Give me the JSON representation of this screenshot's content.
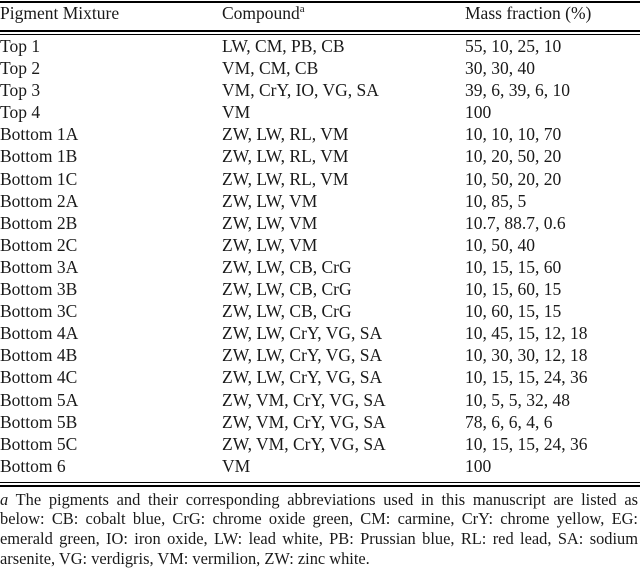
{
  "table": {
    "footnote_marker": "a",
    "columns": [
      {
        "key": "mixture",
        "label": "Pigment Mixture"
      },
      {
        "key": "compound",
        "label": "Compound"
      },
      {
        "key": "mass",
        "label": "Mass fraction (%)"
      }
    ],
    "rows": [
      {
        "mixture": "Top 1",
        "compound": "LW, CM, PB, CB",
        "mass": "55, 10, 25, 10"
      },
      {
        "mixture": "Top 2",
        "compound": "VM, CM, CB",
        "mass": "30, 30, 40"
      },
      {
        "mixture": "Top 3",
        "compound": "VM, CrY, IO, VG, SA",
        "mass": "39, 6, 39, 6, 10"
      },
      {
        "mixture": "Top 4",
        "compound": "VM",
        "mass": "100"
      },
      {
        "mixture": "Bottom 1A",
        "compound": "ZW, LW, RL, VM",
        "mass": "10, 10, 10, 70"
      },
      {
        "mixture": "Bottom 1B",
        "compound": "ZW, LW, RL, VM",
        "mass": "10, 20, 50, 20"
      },
      {
        "mixture": "Bottom 1C",
        "compound": "ZW, LW, RL, VM",
        "mass": "10, 50, 20, 20"
      },
      {
        "mixture": "Bottom 2A",
        "compound": "ZW, LW, VM",
        "mass": "10, 85, 5"
      },
      {
        "mixture": "Bottom 2B",
        "compound": "ZW, LW, VM",
        "mass": "10.7, 88.7, 0.6"
      },
      {
        "mixture": "Bottom 2C",
        "compound": "ZW, LW, VM",
        "mass": "10, 50, 40"
      },
      {
        "mixture": "Bottom 3A",
        "compound": "ZW, LW, CB, CrG",
        "mass": "10, 15, 15, 60"
      },
      {
        "mixture": "Bottom 3B",
        "compound": "ZW, LW, CB, CrG",
        "mass": "10, 15, 60, 15"
      },
      {
        "mixture": "Bottom 3C",
        "compound": "ZW, LW, CB, CrG",
        "mass": "10, 60, 15, 15"
      },
      {
        "mixture": "Bottom 4A",
        "compound": "ZW, LW, CrY, VG, SA",
        "mass": "10, 45, 15, 12, 18"
      },
      {
        "mixture": "Bottom 4B",
        "compound": "ZW, LW, CrY, VG, SA",
        "mass": "10, 30, 30, 12, 18"
      },
      {
        "mixture": "Bottom 4C",
        "compound": "ZW, LW, CrY, VG, SA",
        "mass": "10, 15, 15, 24, 36"
      },
      {
        "mixture": "Bottom 5A",
        "compound": "ZW, VM, CrY, VG, SA",
        "mass": "10, 5, 5, 32, 48"
      },
      {
        "mixture": "Bottom 5B",
        "compound": "ZW, VM, CrY, VG, SA",
        "mass": "78, 6, 6, 4, 6"
      },
      {
        "mixture": "Bottom 5C",
        "compound": "ZW, VM, CrY, VG, SA",
        "mass": "10, 15, 15, 24, 36"
      },
      {
        "mixture": "Bottom 6",
        "compound": "VM",
        "mass": "100"
      }
    ]
  },
  "footnote": {
    "letter": "a",
    "text": "The pigments and their corresponding abbreviations used in this manuscript are listed as below: CB: cobalt blue, CrG: chrome oxide green, CM: carmine, CrY: chrome yellow, EG: emerald green, IO: iron oxide, LW: lead white, PB: Prussian blue, RL: red lead, SA: sodium arsenite, VG: verdigris, VM: vermilion, ZW: zinc white."
  }
}
